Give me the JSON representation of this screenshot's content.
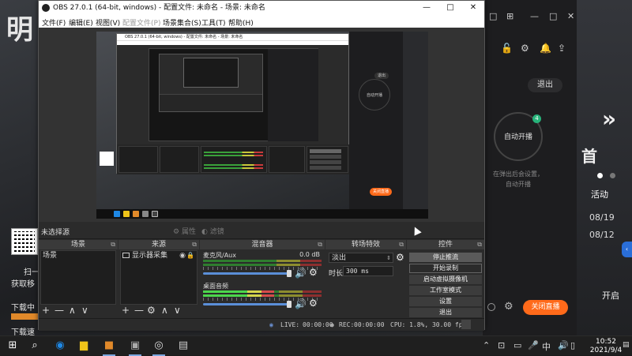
{
  "background": {
    "game_big_char": "明",
    "left_texts": [
      "扫一",
      "获取移",
      "下载中",
      "下载速"
    ],
    "client_titlebar": [
      "□",
      "⊞",
      "—",
      "□",
      "✕"
    ],
    "client_exit": "退出",
    "client_start_live_circle": "自动开播",
    "client_circle_badge": "4",
    "client_hint_lines": [
      "在弹出后会设置，",
      "自动开播"
    ],
    "client_start_btn": "关闭直播",
    "side_activity": "活动",
    "side_dates": [
      "08/19",
      "08/12"
    ],
    "side_kai": "开启",
    "side_big_char": "首"
  },
  "obs": {
    "title": "OBS 27.0.1 (64-bit, windows) - 配置文件: 未命名 - 场景: 未命名",
    "window_controls": {
      "minimize": "—",
      "maximize": "□",
      "close": "✕"
    },
    "menu": [
      {
        "label": "文件(F)",
        "enabled": true
      },
      {
        "label": "编辑(E)",
        "enabled": true
      },
      {
        "label": "视图(V)",
        "enabled": true
      },
      {
        "label": "配置文件(P)",
        "enabled": false
      },
      {
        "label": "场景集合(S)",
        "enabled": true
      },
      {
        "label": "工具(T)",
        "enabled": true
      },
      {
        "label": "帮助(H)",
        "enabled": true
      }
    ],
    "preview": {
      "nested_title": "OBS 27.0.1 (64-bit, windows) - 配置文件: 未命名 - 场景: 未命名",
      "client_circle": "自动开播",
      "client_exit": "退出",
      "client_btn": "关闭直播"
    },
    "props_bar": {
      "no_source": "未选择源",
      "properties": "属性",
      "filters": "滤镜"
    },
    "docks": {
      "scenes": {
        "title": "场景",
        "items": [
          "场景"
        ],
        "footer": [
          "+",
          "—",
          "∧",
          "∨"
        ]
      },
      "sources": {
        "title": "来源",
        "items": [
          {
            "label": "显示器采集",
            "visible": true,
            "locked": true
          }
        ],
        "footer": [
          "+",
          "—",
          "⚙",
          "∧",
          "∨"
        ]
      },
      "mixer": {
        "title": "混音器",
        "tracks": [
          {
            "name": "麦克风/Aux",
            "db": "0.0 dB"
          },
          {
            "name": "桌面音频",
            "db": "0.0 dB"
          }
        ]
      },
      "transitions": {
        "title": "转场特效",
        "selected": "淡出",
        "duration_label": "时长",
        "duration_value": "300 ms"
      },
      "controls": {
        "title": "控件",
        "buttons": [
          "停止推流",
          "开始录制",
          "启动虚拟摄像机",
          "工作室模式",
          "设置",
          "退出"
        ]
      }
    },
    "statusbar": {
      "live_label": "LIVE:",
      "live_time": "00:00:00",
      "rec_label": "REC:",
      "rec_time": "00:00:00",
      "cpu": "CPU: 1.8%, 30.00 fps"
    }
  },
  "taskbar": {
    "time": "10:52",
    "date": "2021/9/4",
    "ime": "中",
    "tray_icons": [
      "network-icon",
      "volume-icon",
      "ime-icon",
      "notification-icon"
    ]
  },
  "colors": {
    "orange_accent": "#ff6a1a",
    "obs_dark": "#2b2b2b",
    "meter_green": "#4cd64c"
  }
}
